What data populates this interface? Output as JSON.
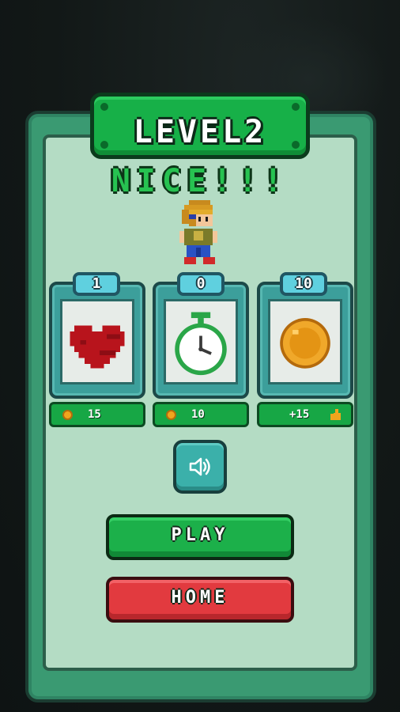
{
  "title": "LEVEL2",
  "subtitle": "NICE!!!",
  "powerups": [
    {
      "name": "heart",
      "icon": "heart-icon",
      "count": "1",
      "price": "15",
      "price_icon": "coin-icon"
    },
    {
      "name": "stopwatch",
      "icon": "stopwatch-icon",
      "count": "0",
      "price": "10",
      "price_icon": "coin-icon"
    },
    {
      "name": "coin",
      "icon": "gold-coin-icon",
      "count": "10",
      "price": "+15",
      "price_icon": "thumbs-up-icon"
    }
  ],
  "buttons": {
    "sound_icon": "speaker-icon",
    "play": "PLAY",
    "home": "HOME"
  },
  "colors": {
    "panel": "#3a9a72",
    "panel_inner": "#b4dcc4",
    "title_plate": "#17b048",
    "subtitle_text": "#27c251",
    "play_button": "#1cb04a",
    "home_button": "#e23a3f",
    "card": "#3c9f9b"
  }
}
